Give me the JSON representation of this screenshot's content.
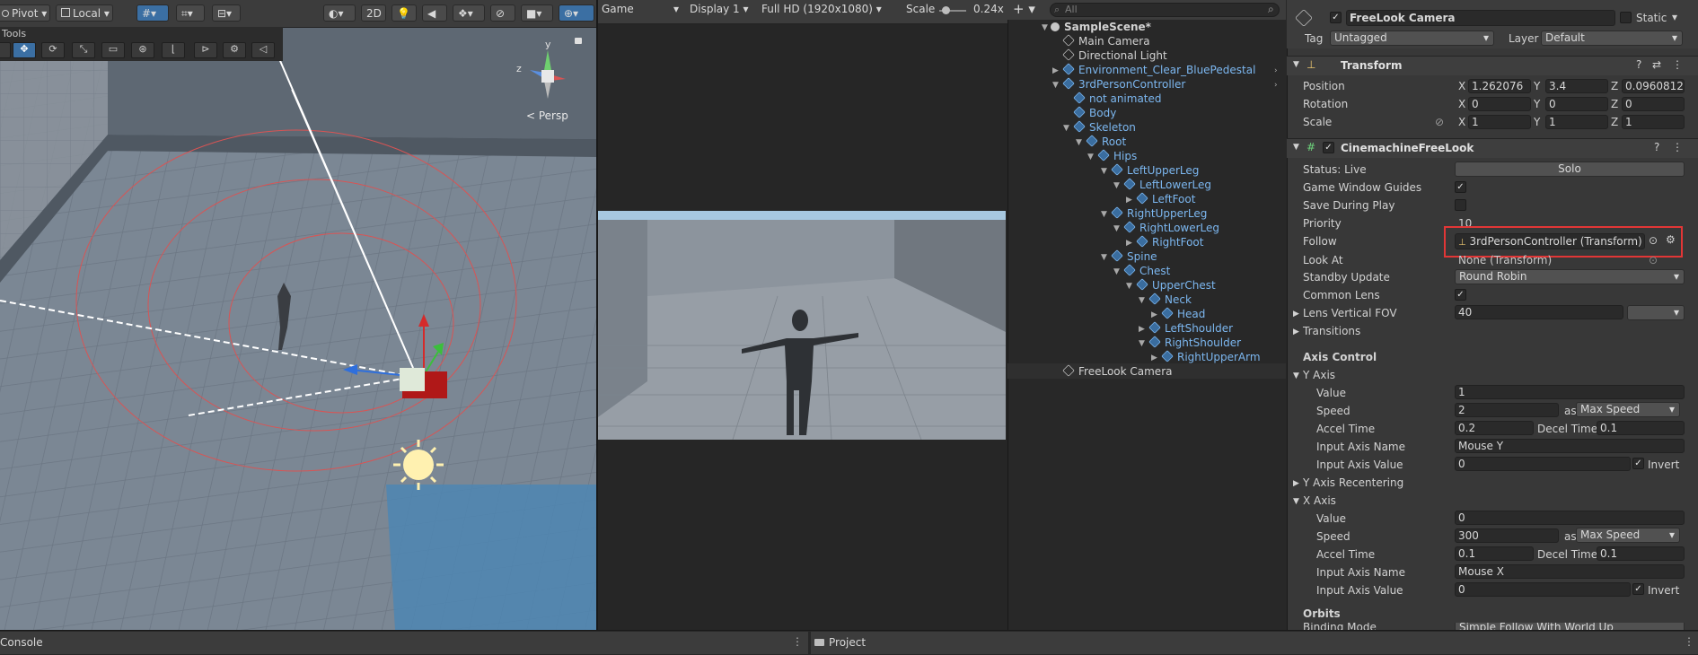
{
  "scene_toolbar": {
    "pivot": "Pivot",
    "local": "Local",
    "mode_2d": "2D",
    "tools_title": "Tools",
    "persp_label": "< Persp",
    "gizmo_y": "y",
    "gizmo_z": "z"
  },
  "game_toolbar": {
    "game": "Game",
    "display": "Display 1",
    "resolution": "Full HD (1920x1080)",
    "scale_label": "Scale",
    "scale_value": "0.24x"
  },
  "hierarchy": {
    "search_placeholder": "All",
    "items": [
      {
        "label": "SampleScene*",
        "prefab": false
      },
      {
        "label": "Main Camera",
        "prefab": false
      },
      {
        "label": "Directional Light",
        "prefab": false
      },
      {
        "label": "Environment_Clear_BluePedestal",
        "prefab": true
      },
      {
        "label": "3rdPersonController",
        "prefab": true
      },
      {
        "label": "not animated",
        "prefab": true
      },
      {
        "label": "Body",
        "prefab": true
      },
      {
        "label": "Skeleton",
        "prefab": true
      },
      {
        "label": "Root",
        "prefab": true
      },
      {
        "label": "Hips",
        "prefab": true
      },
      {
        "label": "LeftUpperLeg",
        "prefab": true
      },
      {
        "label": "LeftLowerLeg",
        "prefab": true
      },
      {
        "label": "LeftFoot",
        "prefab": true
      },
      {
        "label": "RightUpperLeg",
        "prefab": true
      },
      {
        "label": "RightLowerLeg",
        "prefab": true
      },
      {
        "label": "RightFoot",
        "prefab": true
      },
      {
        "label": "Spine",
        "prefab": true
      },
      {
        "label": "Chest",
        "prefab": true
      },
      {
        "label": "UpperChest",
        "prefab": true
      },
      {
        "label": "Neck",
        "prefab": true
      },
      {
        "label": "Head",
        "prefab": true
      },
      {
        "label": "LeftShoulder",
        "prefab": true
      },
      {
        "label": "RightShoulder",
        "prefab": true
      },
      {
        "label": "RightUpperArm",
        "prefab": true
      },
      {
        "label": "FreeLook Camera",
        "prefab": false
      }
    ]
  },
  "inspector": {
    "object_name": "FreeLook Camera",
    "static_label": "Static",
    "tag_label": "Tag",
    "tag_value": "Untagged",
    "layer_label": "Layer",
    "layer_value": "Default",
    "transform": {
      "title": "Transform",
      "position_label": "Position",
      "rotation_label": "Rotation",
      "scale_label": "Scale",
      "x": "X",
      "y": "Y",
      "z": "Z",
      "position": [
        "1.262076",
        "3.4",
        "0.0960812"
      ],
      "rotation": [
        "0",
        "0",
        "0"
      ],
      "scale": [
        "1",
        "1",
        "1"
      ]
    },
    "freelook": {
      "title": "CinemachineFreeLook",
      "status_label": "Status: Live",
      "solo_button": "Solo",
      "game_window_guides": "Game Window Guides",
      "save_during_play": "Save During Play",
      "priority_label": "Priority",
      "priority_value": "10",
      "follow_label": "Follow",
      "follow_value": "3rdPersonController (Transform)",
      "look_at_label": "Look At",
      "look_at_value": "None (Transform)",
      "standby_label": "Standby Update",
      "standby_value": "Round Robin",
      "common_lens": "Common Lens",
      "lens_fov_label": "Lens Vertical FOV",
      "lens_fov_value": "40",
      "transitions": "Transitions",
      "axis_control": "Axis Control",
      "y_axis": {
        "title": "Y Axis",
        "value_label": "Value",
        "value": "1",
        "speed_label": "Speed",
        "speed": "2",
        "as_label": "as",
        "speed_mode": "Max Speed",
        "accel_label": "Accel Time",
        "accel": "0.2",
        "decel_label": "Decel Time",
        "decel": "0.1",
        "input_name_label": "Input Axis Name",
        "input_name": "Mouse Y",
        "input_value_label": "Input Axis Value",
        "input_value": "0",
        "invert": "Invert"
      },
      "y_recentering": "Y Axis Recentering",
      "x_axis": {
        "title": "X Axis",
        "value_label": "Value",
        "value": "0",
        "speed_label": "Speed",
        "speed": "300",
        "as_label": "as",
        "speed_mode": "Max Speed",
        "accel_label": "Accel Time",
        "accel": "0.1",
        "decel_label": "Decel Time",
        "decel": "0.1",
        "input_name_label": "Input Axis Name",
        "input_name": "Mouse X",
        "input_value_label": "Input Axis Value",
        "input_value": "0",
        "invert": "Invert"
      },
      "orbits": "Orbits",
      "binding_mode_label": "Binding Mode",
      "binding_mode_value": "Simple Follow With World Up"
    }
  },
  "bottom": {
    "console": "Console",
    "project": "Project"
  },
  "colors": {
    "highlight_box": "#e23636",
    "prefab_blue": "#7cb7f0",
    "active_tool": "#3b6fa3"
  }
}
